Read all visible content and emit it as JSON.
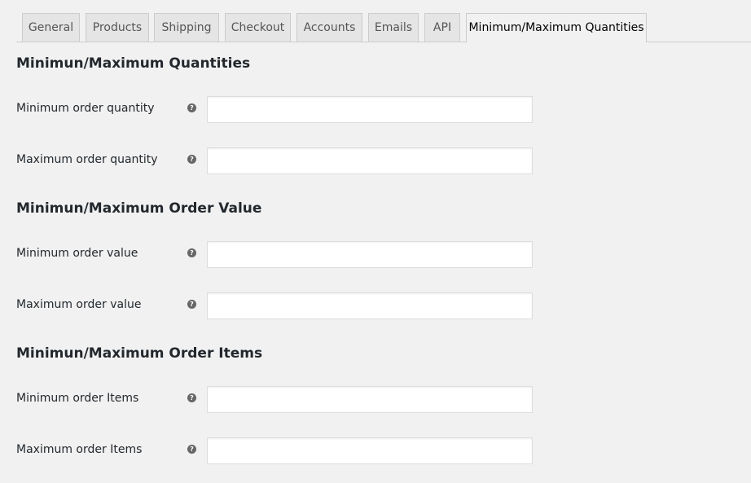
{
  "tabs": [
    {
      "label": "General"
    },
    {
      "label": "Products"
    },
    {
      "label": "Shipping"
    },
    {
      "label": "Checkout"
    },
    {
      "label": "Accounts"
    },
    {
      "label": "Emails"
    },
    {
      "label": "API"
    },
    {
      "label": "Minimum/Maximum Quantities",
      "active": true
    }
  ],
  "sections": [
    {
      "title": "Minimun/Maximum Quantities",
      "fields": [
        {
          "label": "Minimum order quantity",
          "value": "",
          "help_icon": "question-circle-icon"
        },
        {
          "label": "Maximum order quantity",
          "value": "",
          "help_icon": "question-circle-icon"
        }
      ]
    },
    {
      "title": "Minimun/Maximum Order Value",
      "fields": [
        {
          "label": "Minimum order value",
          "value": "",
          "help_icon": "question-circle-icon"
        },
        {
          "label": "Maximum order value",
          "value": "",
          "help_icon": "question-circle-icon"
        }
      ]
    },
    {
      "title": "Minimun/Maximum Order Items",
      "fields": [
        {
          "label": "Minimum order Items",
          "value": "",
          "help_icon": "question-circle-icon"
        },
        {
          "label": "Maximum order Items",
          "value": "",
          "help_icon": "question-circle-icon"
        }
      ]
    }
  ],
  "help_glyph": "?",
  "colors": {
    "background": "#f1f1f1",
    "tab_inactive": "#e5e5e5",
    "border": "#cccccc",
    "input_background": "#ffffff",
    "help_icon": "#666666"
  }
}
